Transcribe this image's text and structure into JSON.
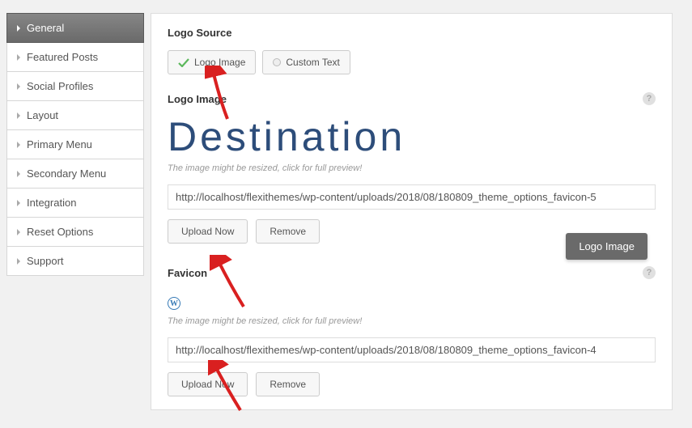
{
  "sidebar": {
    "items": [
      {
        "label": "General",
        "active": true
      },
      {
        "label": "Featured Posts",
        "active": false
      },
      {
        "label": "Social Profiles",
        "active": false
      },
      {
        "label": "Layout",
        "active": false
      },
      {
        "label": "Primary Menu",
        "active": false
      },
      {
        "label": "Secondary Menu",
        "active": false
      },
      {
        "label": "Integration",
        "active": false
      },
      {
        "label": "Reset Options",
        "active": false
      },
      {
        "label": "Support",
        "active": false
      }
    ]
  },
  "main": {
    "logo_source": {
      "title": "Logo Source",
      "option_image": "Logo Image",
      "option_text": "Custom Text"
    },
    "logo_image": {
      "title": "Logo Image",
      "preview_text": "Destination",
      "hint": "The image might be resized, click for full preview!",
      "url": "http://localhost/flexithemes/wp-content/uploads/2018/08/180809_theme_options_favicon-5",
      "upload_label": "Upload Now",
      "remove_label": "Remove"
    },
    "favicon": {
      "title": "Favicon",
      "hint": "The image might be resized, click for full preview!",
      "url": "http://localhost/flexithemes/wp-content/uploads/2018/08/180809_theme_options_favicon-4",
      "upload_label": "Upload Now",
      "remove_label": "Remove"
    },
    "tooltip": "Logo Image"
  }
}
